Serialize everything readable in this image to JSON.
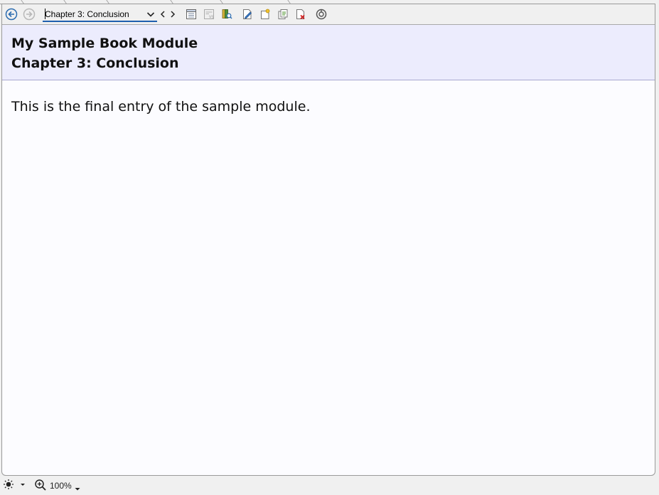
{
  "toolbar": {
    "back_icon": "arrow-left-circle-icon",
    "forward_icon": "arrow-right-circle-icon",
    "chapter_selector": {
      "selected": "Chapter 3: Conclusion"
    },
    "prev_icon": "chevron-left-icon",
    "next_icon": "chevron-right-icon",
    "tool_icons": [
      "table-of-contents-icon",
      "verse-list-icon",
      "book-search-icon",
      "edit-note-icon",
      "new-note-icon",
      "copy-note-icon",
      "delete-note-icon",
      "sync-icon"
    ]
  },
  "content": {
    "book_title": "My Sample Book Module",
    "chapter_title": "Chapter 3: Conclusion",
    "body": "This is the final entry of the sample module."
  },
  "statusbar": {
    "theme_icon": "sun-icon",
    "zoom_icon": "zoom-in-icon",
    "zoom_label": "100%"
  },
  "colors": {
    "header_band": "#ececfd",
    "content_bg": "#fcfcff",
    "accent": "#1f5fae"
  }
}
